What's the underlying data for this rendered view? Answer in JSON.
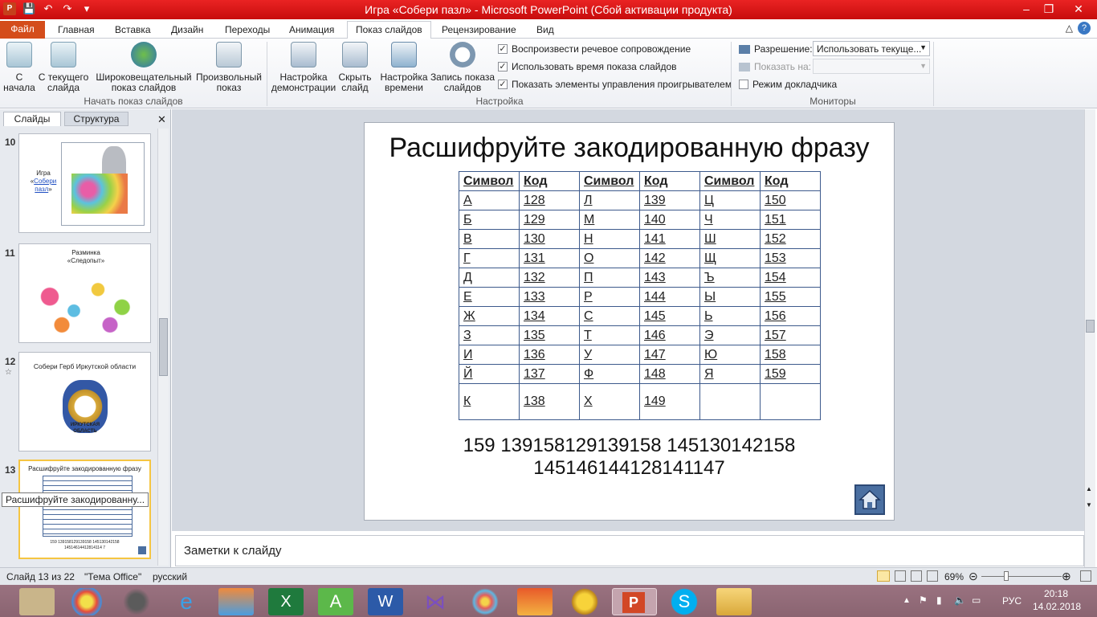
{
  "window": {
    "title": "Игра «Собери пазл»  -  Microsoft PowerPoint (Сбой активации продукта)"
  },
  "tabs": [
    "Файл",
    "Главная",
    "Вставка",
    "Дизайн",
    "Переходы",
    "Анимация",
    "Показ слайдов",
    "Рецензирование",
    "Вид"
  ],
  "ribbon": {
    "start_group": {
      "label": "Начать показ слайдов",
      "buttons": [
        "С начала",
        "С текущего слайда",
        "Широковещательный показ слайдов",
        "Произвольный показ"
      ]
    },
    "setup_group": {
      "label": "Настройка",
      "buttons": [
        "Настройка демонстрации",
        "Скрыть слайд",
        "Настройка времени",
        "Запись показа слайдов"
      ],
      "checkboxes": [
        "Воспроизвести речевое сопровождение",
        "Использовать время показа слайдов",
        "Показать элементы управления проигрывателем"
      ]
    },
    "monitors_group": {
      "label": "Мониторы",
      "resolution_label": "Разрешение:",
      "resolution_value": "Использовать текуще...",
      "show_on_label": "Показать на:",
      "presenter_view": "Режим докладчика"
    }
  },
  "left_pane": {
    "tabs": [
      "Слайды",
      "Структура"
    ],
    "slides": [
      {
        "num": "10",
        "text1": "Игра «",
        "link": "Собери пазл",
        "text2": "»"
      },
      {
        "num": "11",
        "text": "Разминка «Следопыт»"
      },
      {
        "num": "12",
        "text": "Собери Герб Иркутской области",
        "caption": "ИРКУТСКАЯ ОБЛАСТЬ"
      },
      {
        "num": "13",
        "text": "Расшифруйте закодированную фразу",
        "phrase": "159 139158129139158 145130142158 14514614412814114 7"
      }
    ],
    "tooltip": "Расшифруйте закодированну..."
  },
  "slide": {
    "title": "Расшифруйте закодированную фразу",
    "headers": [
      "Символ",
      "Код",
      "Символ",
      "Код",
      "Символ",
      "Код"
    ],
    "rows": [
      [
        "А",
        "128",
        "Л",
        "139",
        "Ц",
        "150"
      ],
      [
        "Б",
        "129",
        "М",
        "140",
        "Ч",
        "151"
      ],
      [
        "В",
        "130",
        "Н",
        "141",
        "Ш",
        "152"
      ],
      [
        "Г",
        "131",
        "О",
        "142",
        "Щ",
        "153"
      ],
      [
        "Д",
        "132",
        "П",
        "143",
        "Ъ",
        "154"
      ],
      [
        "Е",
        "133",
        "Р",
        "144",
        "Ы",
        "155"
      ],
      [
        "Ж",
        "134",
        "С",
        "145",
        "Ь",
        "156"
      ],
      [
        "З",
        "135",
        "Т",
        "146",
        "Э",
        "157"
      ],
      [
        "И",
        "136",
        "У",
        "147",
        "Ю",
        "158"
      ],
      [
        "Й",
        "137",
        "Ф",
        "148",
        "Я",
        "159"
      ],
      [
        "К",
        "138",
        "Х",
        "149",
        "",
        ""
      ]
    ],
    "phrase_line1": "159 139158129139158  145130142158",
    "phrase_line2": "145146144128141147"
  },
  "notes": {
    "placeholder": "Заметки к слайду"
  },
  "status": {
    "slide": "Слайд 13 из 22",
    "theme": "\"Тема Office\"",
    "lang": "русский",
    "zoom": "69%"
  },
  "tray": {
    "lang": "РУС",
    "time": "20:18",
    "date": "14.02.2018"
  },
  "colors": {
    "titlebar": "#d91a1a",
    "file_tab": "#d44d1b",
    "table_border": "#3d5a8c",
    "taskbar": "#8f6977"
  }
}
